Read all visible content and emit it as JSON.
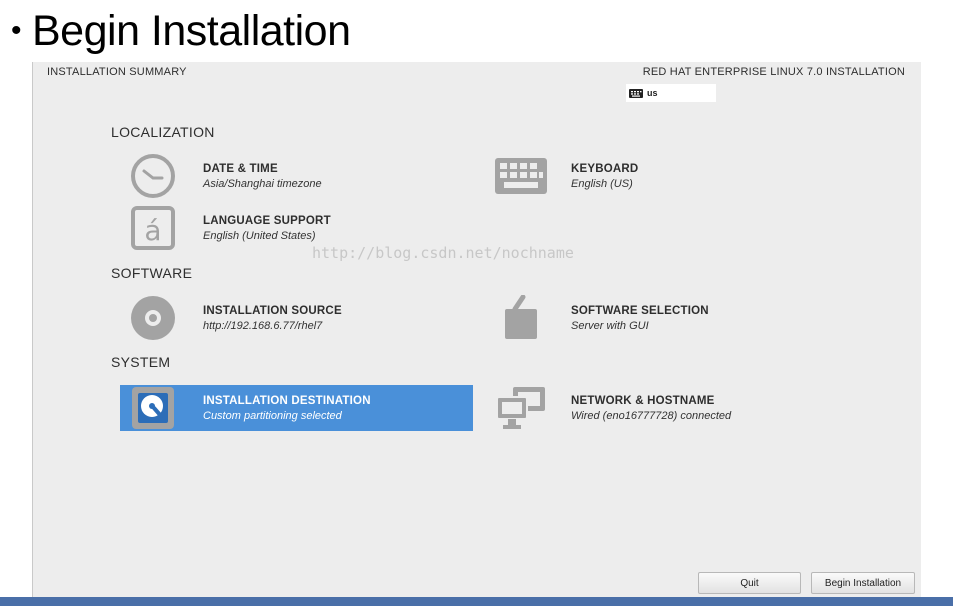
{
  "slide": {
    "bullet": "•",
    "title": "Begin Installation"
  },
  "header": {
    "left_title": "INSTALLATION SUMMARY",
    "right_title": "RED HAT ENTERPRISE LINUX 7.0 INSTALLATION",
    "keyboard_indicator": "us"
  },
  "sections": {
    "localization": "LOCALIZATION",
    "software": "SOFTWARE",
    "system": "SYSTEM"
  },
  "spokes": {
    "date_time": {
      "title": "DATE & TIME",
      "status": "Asia/Shanghai timezone",
      "icon": "clock-icon"
    },
    "keyboard": {
      "title": "KEYBOARD",
      "status": "English (US)",
      "icon": "keyboard-icon"
    },
    "language": {
      "title": "LANGUAGE SUPPORT",
      "status": "English (United States)",
      "icon": "language-icon"
    },
    "install_source": {
      "title": "INSTALLATION SOURCE",
      "status": "http://192.168.6.77/rhel7",
      "icon": "disc-icon"
    },
    "software_selection": {
      "title": "SOFTWARE SELECTION",
      "status": "Server with GUI",
      "icon": "package-icon"
    },
    "install_destination": {
      "title": "INSTALLATION DESTINATION",
      "status": "Custom partitioning selected",
      "icon": "harddisk-icon",
      "selected": true
    },
    "network": {
      "title": "NETWORK & HOSTNAME",
      "status": "Wired (eno16777728) connected",
      "icon": "network-icon"
    }
  },
  "buttons": {
    "quit": "Quit",
    "begin": "Begin Installation"
  },
  "watermark": "http://blog.csdn.net/nochname",
  "colors": {
    "selected": "#4a90d9",
    "panel": "#ededed",
    "bottom_bar": "#4a6fa8"
  }
}
